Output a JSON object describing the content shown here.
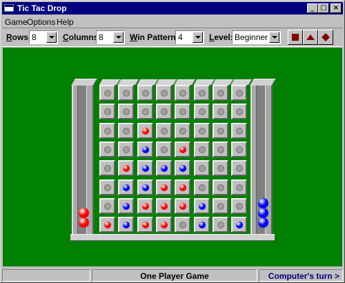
{
  "window": {
    "title": "Tic Tac Drop",
    "buttons": {
      "minimize": "_",
      "maximize": "□",
      "close": "×"
    }
  },
  "menu": [
    "Game",
    "Options",
    "Help"
  ],
  "toolbar": {
    "rows": {
      "accel": "R",
      "rest": "ows:",
      "value": "8"
    },
    "columns": {
      "accel": "C",
      "rest": "olumns:",
      "value": "8"
    },
    "win_pattern": {
      "accel": "W",
      "rest": "in Pattern:",
      "value": "4"
    },
    "level": {
      "accel": "L",
      "rest": "evel:",
      "value": "Beginner"
    },
    "buttons": [
      "stop-square-icon",
      "eject-up-icon",
      "options-diamond-icon"
    ]
  },
  "colors": {
    "red": "#ff0000",
    "blue": "#0000ff",
    "field": "#008000",
    "accent": "#000080"
  },
  "board": {
    "rows": 8,
    "cols": 8,
    "cells": [
      [
        "",
        "",
        "",
        "",
        "",
        "",
        "",
        ""
      ],
      [
        "",
        "",
        "",
        "",
        "",
        "",
        "",
        ""
      ],
      [
        "",
        "",
        "R",
        "",
        "",
        "",
        "",
        ""
      ],
      [
        "",
        "",
        "B",
        "",
        "R",
        "",
        "",
        ""
      ],
      [
        "",
        "R",
        "B",
        "B",
        "B",
        "",
        "",
        ""
      ],
      [
        "",
        "B",
        "B",
        "R",
        "R",
        "",
        "",
        ""
      ],
      [
        "",
        "B",
        "R",
        "R",
        "R",
        "B",
        "",
        ""
      ],
      [
        "R",
        "B",
        "R",
        "R",
        "",
        "B",
        "",
        "B"
      ]
    ],
    "left_stack_red_count": 2,
    "right_stack_blue_count": 3
  },
  "status": {
    "mode": "One Player Game",
    "turn": "Computer's turn >"
  }
}
